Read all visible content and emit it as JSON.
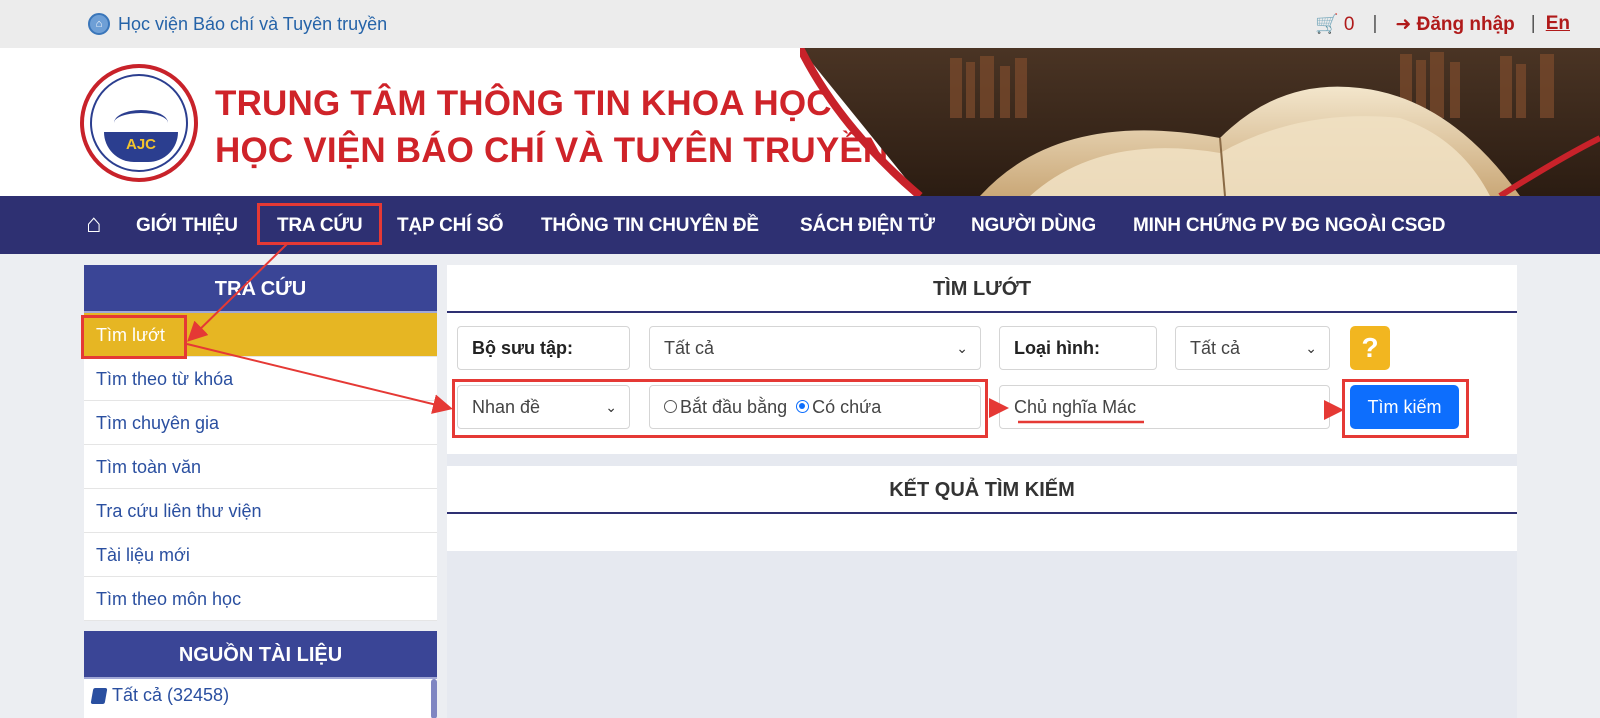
{
  "topbar": {
    "home_label": "Học viện Báo chí và Tuyên truyền",
    "cart_count": "0",
    "login_label": "Đăng nhập",
    "lang_label": "En"
  },
  "header": {
    "title_line1": "TRUNG TÂM THÔNG TIN KHOA HỌC",
    "title_line2": "HỌC VIỆN BÁO CHÍ VÀ TUYÊN TRUYỀN",
    "logo_text": "AJC"
  },
  "nav": {
    "items": [
      "GIỚI THIỆU",
      "TRA CỨU",
      "TẠP CHÍ SỐ",
      "THÔNG TIN CHUYÊN ĐỀ",
      "SÁCH ĐIỆN TỬ",
      "NGƯỜI DÙNG",
      "MINH CHỨNG PV ĐG NGOÀI CSGD"
    ]
  },
  "sidebar": {
    "title": "TRA CỨU",
    "items": [
      "Tìm lướt",
      "Tìm theo từ khóa",
      "Tìm chuyên gia",
      "Tìm toàn văn",
      "Tra cứu liên thư viện",
      "Tài liệu mới",
      "Tìm theo môn học"
    ],
    "sources_title": "NGUỒN TÀI LIỆU",
    "sources": [
      "Tất cả (32458)"
    ]
  },
  "search": {
    "title": "TÌM LƯỚT",
    "collection_label": "Bộ sưu tập:",
    "collection_value": "Tất cả",
    "type_label": "Loại hình:",
    "type_value": "Tất cả",
    "help_label": "?",
    "field_value": "Nhan đề",
    "radio_starts": "Bắt đầu bằng",
    "radio_contains": "Có chứa",
    "query_value": "Chủ nghĩa Mác",
    "submit_label": "Tìm kiếm"
  },
  "results": {
    "title": "KẾT QUẢ TÌM KIẾM"
  },
  "colors": {
    "nav_bg": "#2e3072",
    "accent_red": "#cf2329",
    "active_item": "#e6b623",
    "primary_button": "#0d6efd",
    "annotation": "#e53935"
  }
}
